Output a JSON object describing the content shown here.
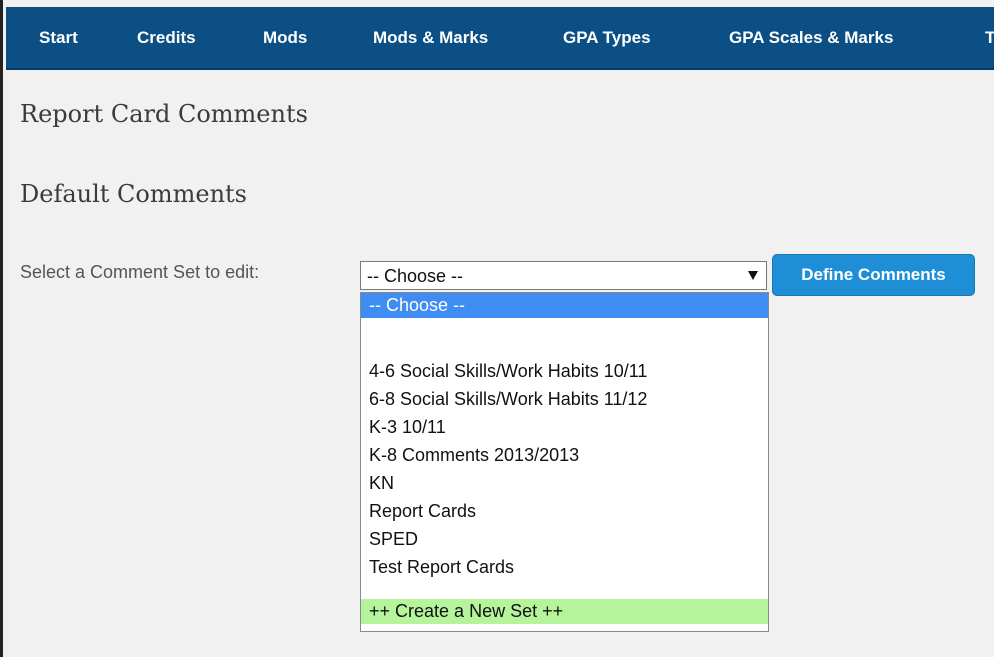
{
  "nav": {
    "items": [
      {
        "label": "Start"
      },
      {
        "label": "Credits"
      },
      {
        "label": "Mods"
      },
      {
        "label": "Mods & Marks"
      },
      {
        "label": "GPA Types"
      },
      {
        "label": "GPA Scales & Marks"
      },
      {
        "label": "T"
      }
    ]
  },
  "page": {
    "title": "Report Card Comments",
    "section_title": "Default Comments"
  },
  "form": {
    "select_label": "Select a Comment Set to edit:",
    "selected_value": "-- Choose --",
    "define_button": "Define Comments",
    "options": [
      {
        "label": "-- Choose --",
        "state": "selected"
      },
      {
        "label": "",
        "state": "normal"
      },
      {
        "label": "4-6 Social Skills/Work Habits 10/11",
        "state": "normal"
      },
      {
        "label": "6-8 Social Skills/Work Habits 11/12",
        "state": "normal"
      },
      {
        "label": "K-3 10/11",
        "state": "normal"
      },
      {
        "label": "K-8 Comments 2013/2013",
        "state": "normal"
      },
      {
        "label": "KN",
        "state": "normal"
      },
      {
        "label": "Report Cards",
        "state": "normal"
      },
      {
        "label": "SPED",
        "state": "normal"
      },
      {
        "label": "Test Report Cards",
        "state": "normal"
      },
      {
        "label": "++ Create a New Set ++",
        "state": "create"
      }
    ]
  },
  "colors": {
    "nav_background": "#0b4f84",
    "button_background": "#1e8fd6",
    "option_selected": "#3f8df2",
    "option_create": "#b6f49c"
  }
}
